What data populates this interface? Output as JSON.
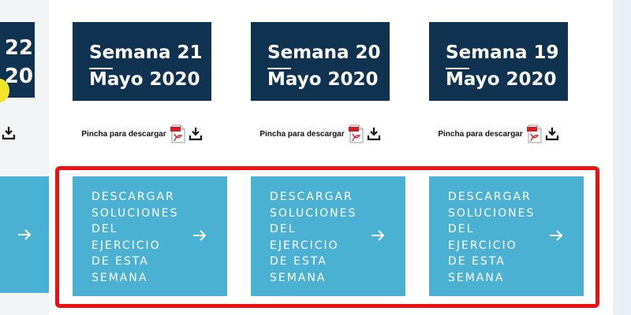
{
  "colors": {
    "title_bg": "#0f3250",
    "button_bg": "#4bb1d2",
    "highlight": "#ee1111",
    "pdf_red": "#d0202a"
  },
  "partial_card": {
    "title_line1": "22",
    "title_line2": "20"
  },
  "cards": [
    {
      "week": "Semana 21",
      "month": "Mayo 2020",
      "download_label": "Pincha para descargar",
      "pdf_icon": "pdf-file-icon",
      "download_icon": "download-arrow-icon",
      "button_lines": [
        "DESCARGAR",
        "SOLUCIONES",
        "DEL",
        "EJERCICIO",
        "DE ESTA",
        "SEMANA"
      ],
      "button_icon": "arrow-right-icon"
    },
    {
      "week": "Semana 20",
      "month": "Mayo 2020",
      "download_label": "Pincha para descargar",
      "pdf_icon": "pdf-file-icon",
      "download_icon": "download-arrow-icon",
      "button_lines": [
        "DESCARGAR",
        "SOLUCIONES",
        "DEL",
        "EJERCICIO",
        "DE ESTA",
        "SEMANA"
      ],
      "button_icon": "arrow-right-icon"
    },
    {
      "week": "Semana 19",
      "month": "Mayo 2020",
      "download_label": "Pincha para descargar",
      "pdf_icon": "pdf-file-icon",
      "download_icon": "download-arrow-icon",
      "button_lines": [
        "DESCARGAR",
        "SOLUCIONES",
        "DEL",
        "EJERCICIO",
        "DE ESTA",
        "SEMANA"
      ],
      "button_icon": "arrow-right-icon"
    }
  ]
}
